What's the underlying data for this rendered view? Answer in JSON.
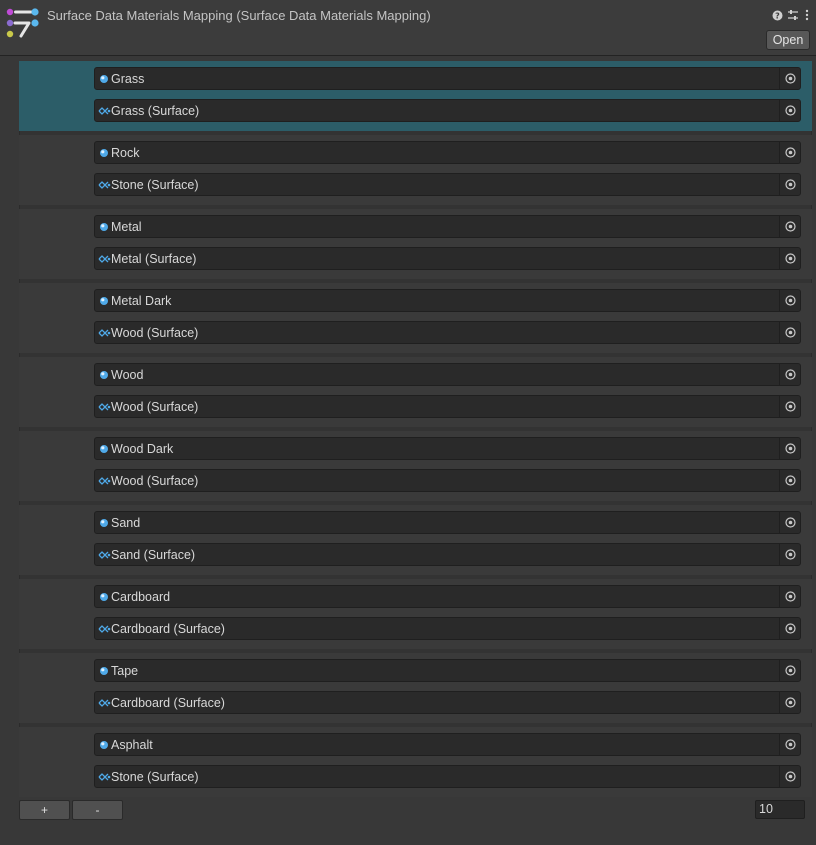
{
  "header": {
    "title": "Surface Data Materials Mapping (Surface Data Materials Mapping)",
    "open_label": "Open",
    "icons": [
      "help-icon",
      "settings-sliders-icon",
      "more-vert-icon"
    ]
  },
  "colors": {
    "selected_row": "#2c5d68",
    "material_icon": "#4fa9e8",
    "surface_icon": "#4fa9e8"
  },
  "list": {
    "elements": [
      {
        "material": "Grass",
        "surface": "Grass (Surface)",
        "selected": true
      },
      {
        "material": "Rock",
        "surface": "Stone (Surface)"
      },
      {
        "material": "Metal",
        "surface": "Metal (Surface)"
      },
      {
        "material": "Metal Dark",
        "surface": "Wood (Surface)"
      },
      {
        "material": "Wood",
        "surface": "Wood (Surface)"
      },
      {
        "material": "Wood Dark",
        "surface": "Wood (Surface)"
      },
      {
        "material": "Sand",
        "surface": "Sand (Surface)"
      },
      {
        "material": "Cardboard",
        "surface": "Cardboard (Surface)"
      },
      {
        "material": "Tape",
        "surface": "Cardboard (Surface)"
      },
      {
        "material": "Asphalt",
        "surface": "Stone (Surface)"
      }
    ]
  },
  "footer": {
    "add_label": "+",
    "remove_label": "-",
    "count": "10"
  }
}
